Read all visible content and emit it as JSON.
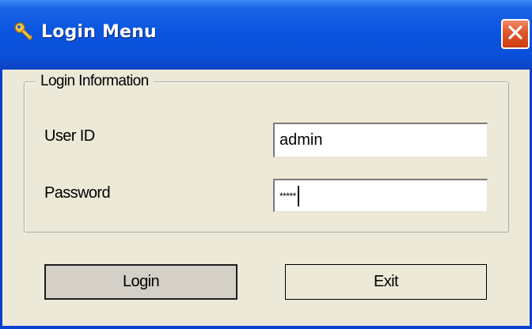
{
  "window": {
    "title": "Login Menu",
    "title_icon": "key-icon",
    "close_icon": "close-icon"
  },
  "group": {
    "legend": "Login Information",
    "user_id_label": "User ID",
    "user_id_value": "admin",
    "password_label": "Password",
    "password_value": "*****"
  },
  "buttons": {
    "login_label": "Login",
    "exit_label": "Exit"
  },
  "colors": {
    "titlebar": "#0a55e0",
    "close_button": "#e15a2d",
    "dialog_background": "#ece9d8"
  }
}
